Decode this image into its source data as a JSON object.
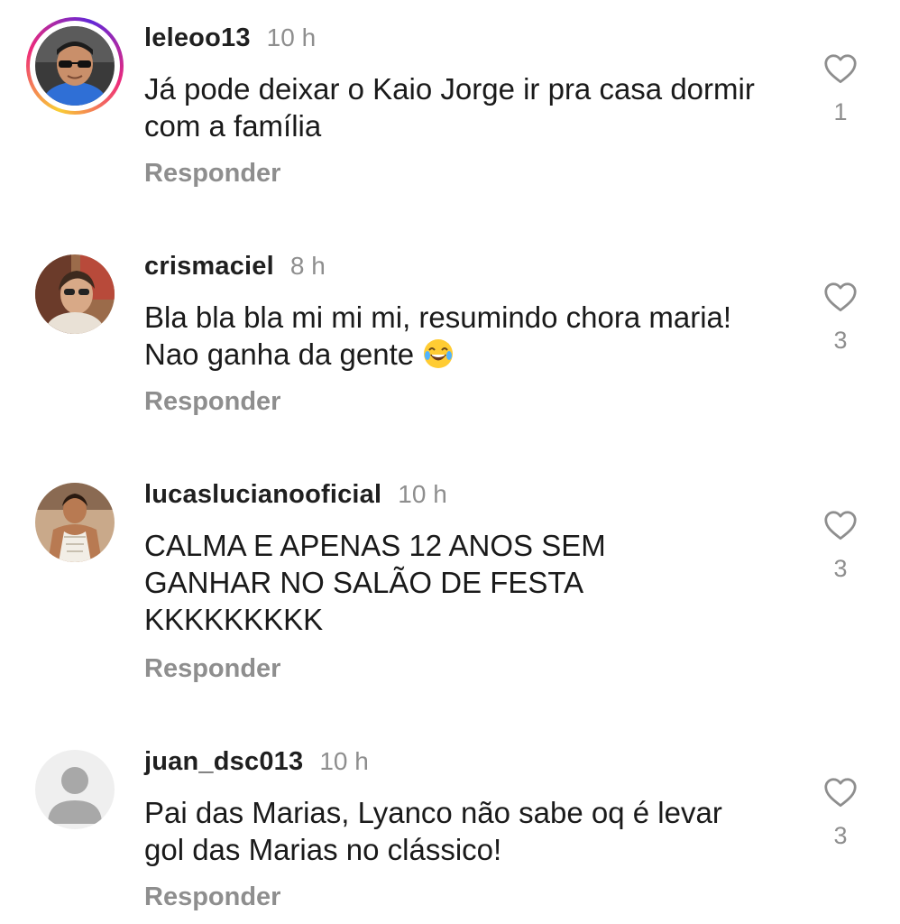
{
  "comments": [
    {
      "username": "leleoo13",
      "time": "10 h",
      "text": "Já pode deixar o Kaio Jorge ir pra casa dormir com a família",
      "reply_label": "Responder",
      "likes": "1",
      "avatar_icon": "user-photo-sunglasses",
      "has_story_ring": true
    },
    {
      "username": "crismaciel",
      "time": "8 h",
      "text": "Bla bla bla mi mi mi, resumindo chora maria! Nao ganha da gente",
      "emoji": "😂",
      "reply_label": "Responder",
      "likes": "3",
      "avatar_icon": "user-photo-sunglasses"
    },
    {
      "username": "lucaslucianooficial",
      "time": "10 h",
      "text": "CALMA E APENAS 12 ANOS SEM GANHAR NO SALÃO DE FESTA KKKKKKKKK",
      "reply_label": "Responder",
      "likes": "3",
      "avatar_icon": "user-photo-beach"
    },
    {
      "username": "juan_dsc013",
      "time": "10 h",
      "text": "Pai das Marias, Lyanco não sabe oq é levar gol das Marias no clássico!",
      "reply_label": "Responder",
      "likes": "3",
      "avatar_icon": "default-avatar-icon"
    }
  ],
  "colors": {
    "text": "#1a1a1a",
    "muted": "#8e8e8e",
    "story_ring": "#ee2a7b"
  }
}
